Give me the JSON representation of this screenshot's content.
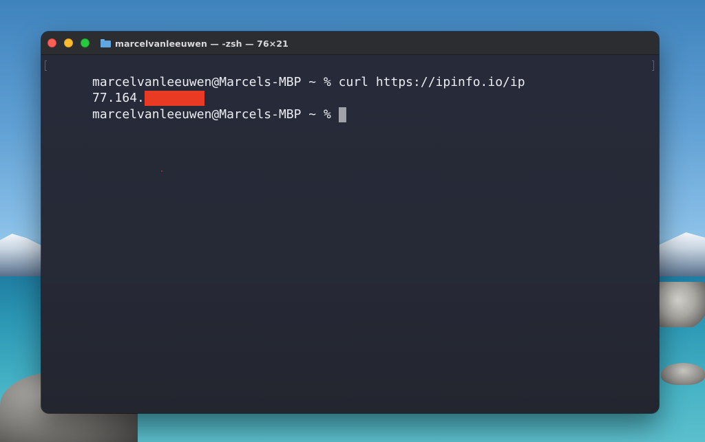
{
  "window": {
    "title": "marcelvanleeuwen — -zsh — 76×21",
    "title_icon": "folder-icon",
    "traffic_lights": {
      "close_color": "#fe5f57",
      "minimize_color": "#febc2e",
      "zoom_color": "#28c840"
    }
  },
  "terminal": {
    "background_color": "#272a38",
    "text_color": "#eceef4",
    "lines": [
      {
        "text": "marcelvanleeuwen@Marcels-MBP ~ % curl https://ipinfo.io/ip"
      },
      {
        "text": "77.164.",
        "redacted": true,
        "redaction_color": "#e93a24"
      },
      {
        "text": "marcelvanleeuwen@Marcels-MBP ~ % ",
        "cursor": true
      }
    ]
  },
  "desktop": {
    "wallpaper": "lake with snowy mountains and rocks"
  }
}
